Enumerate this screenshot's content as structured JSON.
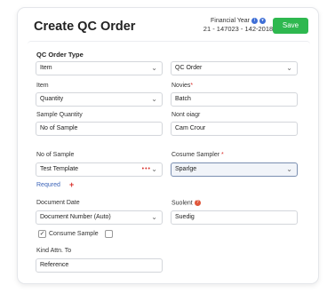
{
  "header": {
    "title": "Create QC Order",
    "financial_year_label": "Financial Year",
    "financial_year_value": "21 - 147023 - 142-2018",
    "save_label": "Save"
  },
  "form": {
    "section_label": "QC Order Type",
    "order_type_left": {
      "value": "Item"
    },
    "order_type_right": {
      "value": "QC Order"
    },
    "item_label": "Item",
    "item_value": "Quantity",
    "novies_label": "Novies",
    "novies_value": "Batch",
    "sample_quantity_label": "Sample Quantity",
    "sample_quantity_value": "No of Sample",
    "nont_label": "Nont oiagr",
    "nont_value": "Cam Crour",
    "no_of_sample_label": "No of Sample",
    "no_of_sample_value": "Test Template",
    "no_of_sample_dots": "•••",
    "consume_sampler_label": "Cosume Sampler",
    "consume_sampler_value": "Sparlge",
    "required_link": "Requred",
    "required_plus": "+",
    "document_date_label": "Document Date",
    "document_date_value": "Document Number (Auto)",
    "suolent_label": "Suolent",
    "suolent_value": "Suedig",
    "consume_sample_label": "Consume Sample",
    "kind_label": "Kind Attn. To",
    "kind_value": "Reference"
  },
  "colors": {
    "accent": "#2eb84f",
    "link": "#3b63b8",
    "required": "#d9302c"
  }
}
